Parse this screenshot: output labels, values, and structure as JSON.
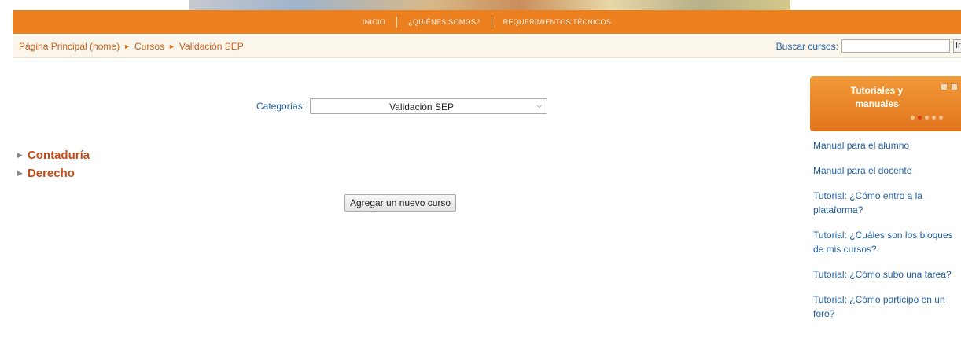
{
  "top_nav": {
    "items": [
      "INICIO",
      "¿QUIÉNES SOMOS?",
      "REQUERIMIENTOS TÉCNICOS"
    ]
  },
  "breadcrumb": {
    "items": [
      "Página Principal (home)",
      "Cursos",
      "Validación SEP"
    ],
    "separator": "►"
  },
  "search": {
    "label": "Buscar cursos:",
    "value": "",
    "button_label": "Ir"
  },
  "categories": {
    "label": "Categorías:",
    "selected": "Validación SEP",
    "list": [
      "Contaduría",
      "Derecho"
    ]
  },
  "add_course_button": "Agregar un nuevo curso",
  "tutorials_block": {
    "title": "Tutoriales y manuales",
    "links": [
      "Manual para el alumno",
      "Manual para el docente",
      "Tutorial: ¿Cómo entro a la plataforma?",
      "Tutorial: ¿Cuáles son los bloques de mis cursos?",
      "Tutorial: ¿Cómo subo una tarea?",
      "Tutorial: ¿Cómo participo en un foro?"
    ]
  },
  "colors": {
    "accent_orange": "#ec7f1e",
    "link_blue": "#1f5fa3",
    "category_red": "#c44e1a"
  }
}
